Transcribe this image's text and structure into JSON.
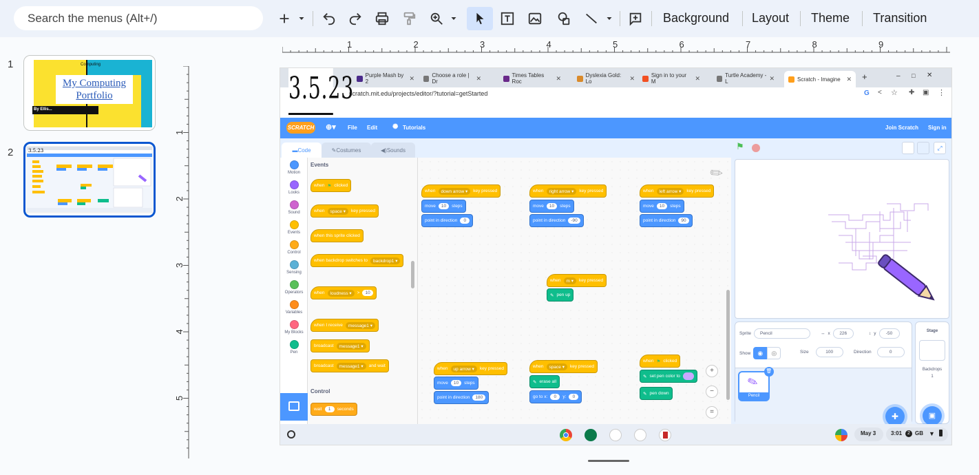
{
  "toolbar": {
    "search_placeholder": "Search the menus (Alt+/)",
    "background_label": "Background",
    "layout_label": "Layout",
    "theme_label": "Theme",
    "transition_label": "Transition",
    "icons": [
      "plus-icon",
      "chevron-down-icon",
      "undo-icon",
      "redo-icon",
      "print-icon",
      "paint-format-icon",
      "zoom-icon",
      "select-icon",
      "text-box-icon",
      "image-icon",
      "shape-icon",
      "line-icon",
      "comment-icon"
    ]
  },
  "filmstrip": {
    "slides": [
      {
        "number": "1",
        "header": "Computing",
        "title_line1": "My Computing",
        "title_line2": "Portfolio",
        "byline": "By Ellis..."
      },
      {
        "number": "2"
      }
    ]
  },
  "ruler": {
    "h_labels": [
      "1",
      "2",
      "3",
      "4",
      "5",
      "6",
      "7",
      "8",
      "9"
    ],
    "v_labels": [
      "1",
      "2",
      "3",
      "4",
      "5"
    ]
  },
  "screenshot": {
    "handwritten_date": "3.5.23",
    "browser": {
      "tabs": [
        {
          "label": "Purple Mash by 2",
          "color": "#4a2a8a"
        },
        {
          "label": "Choose a role | Dr",
          "color": "#777777"
        },
        {
          "label": "Times Tables Roc",
          "color": "#6a2a8a"
        },
        {
          "label": "Dyslexia Gold: Lo",
          "color": "#d98a2b"
        },
        {
          "label": "Sign in to your M",
          "color": "#f25022"
        },
        {
          "label": "Turtle Academy - L",
          "color": "#777777"
        },
        {
          "label": "Scratch - Imagine",
          "color": "#ff9f1c"
        }
      ],
      "url": "scratch.mit.edu/projects/editor/?tutorial=getStarted"
    },
    "scratch": {
      "menu": {
        "logo": "SCRATCH",
        "file": "File",
        "edit": "Edit",
        "tutorials": "Tutorials",
        "join": "Join Scratch",
        "signin": "Sign in"
      },
      "tabs": {
        "code": "Code",
        "costumes": "Costumes",
        "sounds": "Sounds"
      },
      "categories": [
        {
          "label": "Motion",
          "color": "#4c97ff"
        },
        {
          "label": "Looks",
          "color": "#9966ff"
        },
        {
          "label": "Sound",
          "color": "#cf63cf"
        },
        {
          "label": "Events",
          "color": "#ffbf00"
        },
        {
          "label": "Control",
          "color": "#ffab19"
        },
        {
          "label": "Sensing",
          "color": "#5cb1d6"
        },
        {
          "label": "Operators",
          "color": "#59c059"
        },
        {
          "label": "Variables",
          "color": "#ff8c1a"
        },
        {
          "label": "My Blocks",
          "color": "#ff6680"
        },
        {
          "label": "Pen",
          "color": "#0fbd8c"
        }
      ],
      "palette": {
        "events_head": "Events",
        "control_head": "Control",
        "b1_when": "when",
        "b1_clicked": "clicked",
        "b2_when": "when",
        "b2_key": "space",
        "b2_pressed": "key pressed",
        "b3": "when this sprite clicked",
        "b4_text": "when backdrop switches to",
        "b4_val": "backdrop1",
        "b5_when": "when",
        "b5_drop": "loudness",
        "b5_gt": ">",
        "b5_val": "10",
        "b6_text": "when I receive",
        "b6_val": "message1",
        "b7_text": "broadcast",
        "b7_val": "message1",
        "b8_text": "broadcast",
        "b8_val": "message1",
        "b8_tail": "and wait",
        "b9_text": "wait",
        "b9_val": "1",
        "b9_tail": "seconds"
      },
      "scripts": {
        "s1": {
          "when": "when",
          "key": "down arrow",
          "pressed": "key pressed",
          "move": "move",
          "steps_val": "10",
          "steps": "steps",
          "point": "point in direction",
          "dir": "0"
        },
        "s2": {
          "when": "when",
          "key": "right arrow",
          "pressed": "key pressed",
          "move": "move",
          "steps_val": "10",
          "steps": "steps",
          "point": "point in direction",
          "dir": "-90"
        },
        "s3": {
          "when": "when",
          "key": "left arrow",
          "pressed": "key pressed",
          "move": "move",
          "steps_val": "10",
          "steps": "steps",
          "point": "point in direction",
          "dir": "90"
        },
        "s4": {
          "when": "when",
          "key": "m",
          "pressed": "key pressed",
          "action": "pen up"
        },
        "s5": {
          "when": "when",
          "key": "up arrow",
          "pressed": "key pressed",
          "move": "move",
          "steps_val": "10",
          "steps": "steps",
          "point": "point in direction",
          "dir": "180"
        },
        "s6": {
          "when": "when",
          "key": "space",
          "pressed": "key pressed",
          "action": "erase all",
          "goto": "go to x:",
          "x": "0",
          "y_label": "y:",
          "y": "0"
        },
        "s7": {
          "when": "when",
          "clicked": "clicked",
          "setpen": "set pen color to",
          "down": "pen down"
        }
      },
      "sprite_info": {
        "sprite_label": "Sprite",
        "sprite_name": "Pencil",
        "x_label": "x",
        "x": "226",
        "y_label": "y",
        "y": "-50",
        "show_label": "Show",
        "size_label": "Size",
        "size": "100",
        "direction_label": "Direction",
        "direction": "0",
        "tile_name": "Pencil"
      },
      "stage_pane": {
        "title": "Stage",
        "backdrops_label": "Backdrops",
        "backdrops_count": "1"
      }
    },
    "shelf": {
      "date": "May 3",
      "time": "3:01",
      "region": "GB"
    }
  }
}
